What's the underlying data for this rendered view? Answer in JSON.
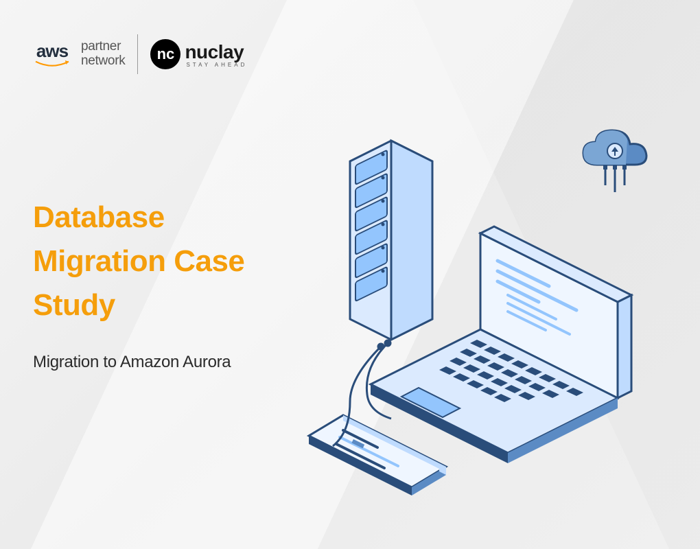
{
  "logos": {
    "aws": {
      "mark": "aws",
      "partner_line1": "partner",
      "partner_line2": "network"
    },
    "nuclay": {
      "mark": "nc",
      "name": "nuclay",
      "tagline": "STAY AHEAD"
    }
  },
  "content": {
    "title_line1": "Database",
    "title_line2": "Migration Case",
    "title_line3": "Study",
    "subtitle": "Migration to Amazon Aurora"
  },
  "colors": {
    "accent_orange": "#f59e0b",
    "aws_orange": "#ff9900",
    "text_dark": "#2a2a2a",
    "illustration_blue_dark": "#2a4d7a",
    "illustration_blue_light": "#b8d4f0"
  }
}
